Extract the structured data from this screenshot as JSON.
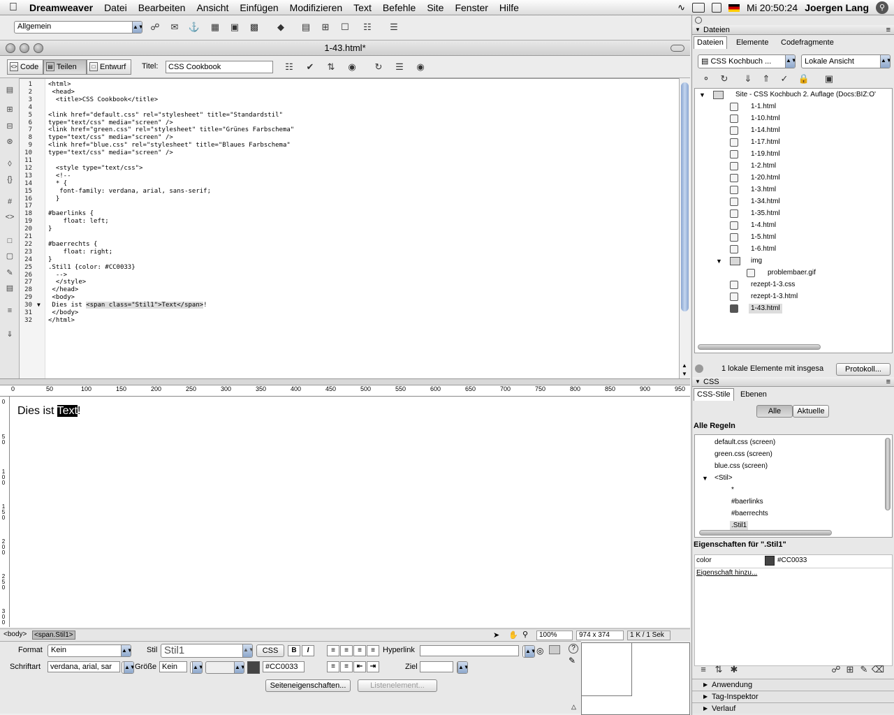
{
  "menubar": {
    "app_name": "Dreamweaver",
    "items": [
      "Datei",
      "Bearbeiten",
      "Ansicht",
      "Einfügen",
      "Modifizieren",
      "Text",
      "Befehle",
      "Site",
      "Fenster",
      "Hilfe"
    ],
    "clock": "Mi 20:50:24",
    "user": "Joergen Lang"
  },
  "insert_bar": {
    "category": "Allgemein"
  },
  "document": {
    "title": "1-43.html*",
    "views": {
      "code": "Code",
      "split": "Teilen",
      "design": "Entwurf"
    },
    "active_view": "Teilen",
    "title_label": "Titel:",
    "title_value": "CSS Cookbook",
    "code_lines": [
      "<html>",
      " <head>",
      "  <title>CSS Cookbook</title>",
      "",
      "<link href=\"default.css\" rel=\"stylesheet\" title=\"Standardstil\"",
      "type=\"text/css\" media=\"screen\" />",
      "<link href=\"green.css\" rel=\"stylesheet\" title=\"Grünes Farbschema\"",
      "type=\"text/css\" media=\"screen\" />",
      "<link href=\"blue.css\" rel=\"stylesheet\" title=\"Blaues Farbschema\"",
      "type=\"text/css\" media=\"screen\" />",
      "",
      "  <style type=\"text/css\">",
      "  <!--",
      "  * {",
      "   font-family: verdana, arial, sans-serif;",
      "  }",
      "",
      "#baerlinks {",
      "    float: left;",
      "}",
      "",
      "#baerrechts {",
      "    float: right;",
      "}",
      ".Stil1 {color: #CC0033}",
      "  -->",
      "  </style>",
      " </head>",
      " <body>",
      " Dies ist <span class=\"Stil1\">Text</span>!",
      " </body>",
      "</html>"
    ],
    "code_line_numbers": [
      "1",
      "2",
      "3",
      "4",
      "5",
      "6",
      "7",
      "8",
      "9",
      "10",
      "11",
      "12",
      "13",
      "14",
      "15",
      "16",
      "17",
      "18",
      "19",
      "20",
      "21",
      "22",
      "23",
      "24",
      "25",
      "26",
      "27",
      "28",
      "29",
      "30",
      "31",
      "32"
    ],
    "design_text_before": "Dies ist ",
    "design_text_selected": "Text",
    "design_text_after": "!",
    "ruler_ticks": [
      "0",
      "50",
      "100",
      "150",
      "200",
      "250",
      "300",
      "350",
      "400",
      "450",
      "500",
      "550",
      "600",
      "650",
      "700",
      "750",
      "800",
      "850",
      "900",
      "950"
    ],
    "vruler_ticks": [
      "0",
      "50",
      "100",
      "150",
      "200",
      "250",
      "300"
    ]
  },
  "status_bar": {
    "tags": [
      "<body>",
      "<span.Stil1>"
    ],
    "zoom": "100%",
    "size": "974 x 374",
    "download": "1 K / 1 Sek"
  },
  "property_inspector": {
    "format_label": "Format",
    "format_value": "Kein",
    "style_label": "Stil",
    "style_value": "Stil1",
    "css_button": "CSS",
    "bold": "B",
    "italic": "I",
    "hyperlink_label": "Hyperlink",
    "hyperlink_value": "",
    "font_label": "Schriftart",
    "font_value": "verdana, arial, sar",
    "size_label": "Größe",
    "size_value": "Kein",
    "color_value": "#CC0033",
    "target_label": "Ziel",
    "target_value": "",
    "page_props_button": "Seiteneigenschaften...",
    "list_item_button": "Listenelement..."
  },
  "files_panel": {
    "title": "Dateien",
    "tabs": [
      "Dateien",
      "Elemente",
      "Codefragmente"
    ],
    "site_select": "CSS Kochbuch ...",
    "view_select": "Lokale Ansicht",
    "root": "Site - CSS Kochbuch 2. Auflage (Docs:BIZ:O'",
    "files": [
      "1-1.html",
      "1-10.html",
      "1-14.html",
      "1-17.html",
      "1-19.html",
      "1-2.html",
      "1-20.html",
      "1-3.html",
      "1-34.html",
      "1-35.html",
      "1-4.html",
      "1-5.html",
      "1-6.html"
    ],
    "folder": "img",
    "folder_files": [
      "problembaer.gif"
    ],
    "files_after": [
      "rezept-1-3.css",
      "rezept-1-3.html",
      "1-43.html"
    ],
    "selected_file": "1-43.html",
    "status": "1 lokale Elemente mit insgesa",
    "log_button": "Protokoll..."
  },
  "css_panel": {
    "title": "CSS",
    "tabs": [
      "CSS-Stile",
      "Ebenen"
    ],
    "toggle": [
      "Alle",
      "Aktuelle"
    ],
    "rules_header": "Alle Regeln",
    "rules": [
      "default.css (screen)",
      "green.css (screen)",
      "blue.css (screen)",
      "<Stil>",
      "*",
      "#baerlinks",
      "#baerrechts",
      ".Stil1"
    ],
    "props_header": "Eigenschaften für \".Stil1\"",
    "prop_name": "color",
    "prop_value": "#CC0033",
    "add_prop": "Eigenschaft hinzu..."
  },
  "bottom_panels": [
    "Anwendung",
    "Tag-Inspektor",
    "Verlauf"
  ],
  "colors": {
    "accent": "#CC0033",
    "selection": "#000000"
  }
}
